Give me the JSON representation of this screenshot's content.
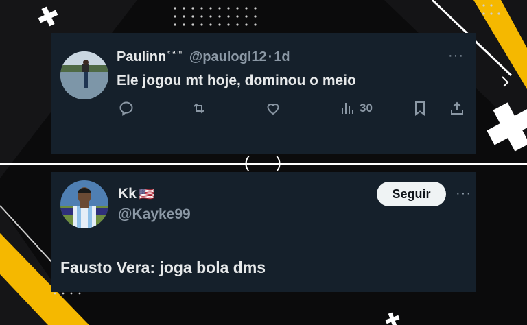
{
  "tweet1": {
    "name": "Paulinn",
    "name_suffix": "ᶜᵃᵐ",
    "handle": "@paulogl12",
    "separator": "·",
    "time": "1d",
    "text": "Ele jogou mt hoje, dominou o meio",
    "more": "···",
    "views": "30",
    "icons": [
      "reply-icon",
      "retweet-icon",
      "like-icon",
      "views-icon",
      "bookmark-icon",
      "share-icon"
    ]
  },
  "tweet2": {
    "name": "Kk",
    "flag": "🇺🇸",
    "handle": "@Kayke99",
    "follow_label": "Seguir",
    "more": "···",
    "text": "Fausto Vera: joga bola dms"
  },
  "divider": {
    "left": "(",
    "right": ")"
  },
  "colors": {
    "card_bg": "#15202b",
    "page_bg": "#0b0b0c",
    "accent_yellow": "#f5b800",
    "muted_text": "#8b98a5"
  }
}
